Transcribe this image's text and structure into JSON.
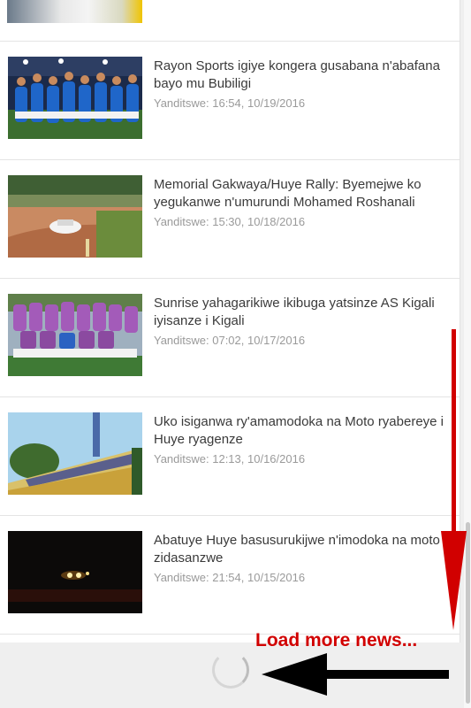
{
  "news": [
    {
      "headline": "Rayon Sports igiye kongera gusabana n'abafana bayo mu Bubiligi",
      "date": "Yanditswe: 16:54, 10/19/2016",
      "thumb": "football-team-photo"
    },
    {
      "headline": "Memorial Gakwaya/Huye Rally: Byemejwe ko yegukanwe n'umurundi Mohamed Roshanali",
      "date": "Yanditswe: 15:30, 10/18/2016",
      "thumb": "rally-car-photo"
    },
    {
      "headline": "Sunrise yahagarikiwe ikibuga yatsinze AS Kigali iyisanze i Kigali",
      "date": "Yanditswe: 07:02, 10/17/2016",
      "thumb": "purple-team-photo"
    },
    {
      "headline": "Uko isiganwa ry'amamodoka na Moto ryabereye i Huye ryagenze",
      "date": "Yanditswe: 12:13, 10/16/2016",
      "thumb": "stadium-crowd-photo"
    },
    {
      "headline": "Abatuye Huye basusurukijwe n'imodoka na moto zidasanzwe",
      "date": "Yanditswe: 21:54, 10/15/2016",
      "thumb": "night-headlights-photo"
    }
  ],
  "annotation": {
    "label": "Load more news...",
    "color": "#d10000"
  },
  "spinner": {
    "icon": "loading-spinner-icon"
  },
  "colors": {
    "headline": "#3a3a3a",
    "date": "#9a9a9a",
    "feed_bg": "#ffffff",
    "page_bg": "#efefef"
  }
}
